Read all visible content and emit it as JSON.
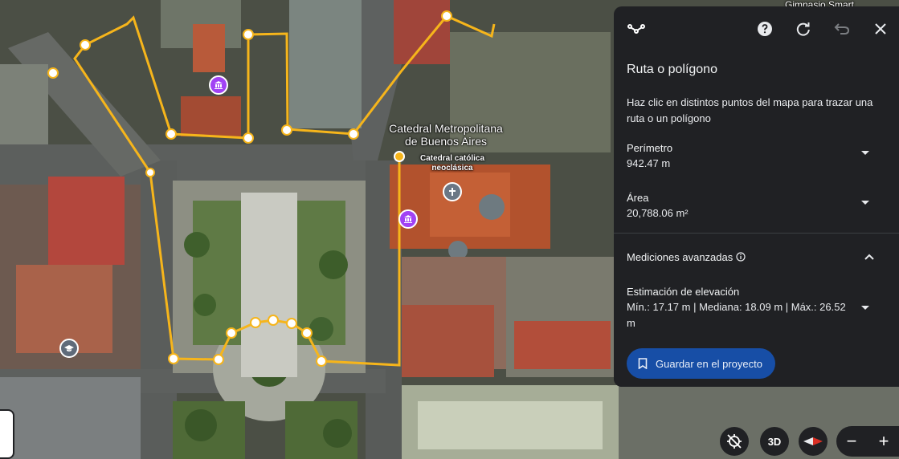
{
  "map": {
    "label_main": "Catedral Metropolitana\nde Buenos Aires",
    "label_sub": "Catedral católica\nneoclásica",
    "label_top": "Gimnasio Smart",
    "poi_museum_color": "#a142f4",
    "poi_church_color": "#6b7785",
    "poi_school_color": "#5f6b7a",
    "route_color": "#f6b51b"
  },
  "toolbar": {
    "measure_icon": "route-measure-icon",
    "help_icon": "help-icon",
    "reset_icon": "refresh-icon",
    "undo_icon": "undo-icon",
    "close_icon": "close-icon"
  },
  "panel": {
    "title": "Ruta o polígono",
    "description": "Haz clic en distintos puntos del mapa para trazar una ruta o un polígono",
    "perimeter_label": "Perímetro",
    "perimeter_value": "942.47 m",
    "area_label": "Área",
    "area_value": "20,788.06 m²",
    "advanced_label": "Mediciones avanzadas",
    "elevation_label": "Estimación de elevación",
    "elevation_values": "Mín.: 17.17 m | Mediana: 18.09 m | Máx.: 26.52 m",
    "save_label": "Guardar en el proyecto"
  },
  "controls": {
    "btn_3d": "3D",
    "zoom_out": "−",
    "zoom_in": "+"
  }
}
